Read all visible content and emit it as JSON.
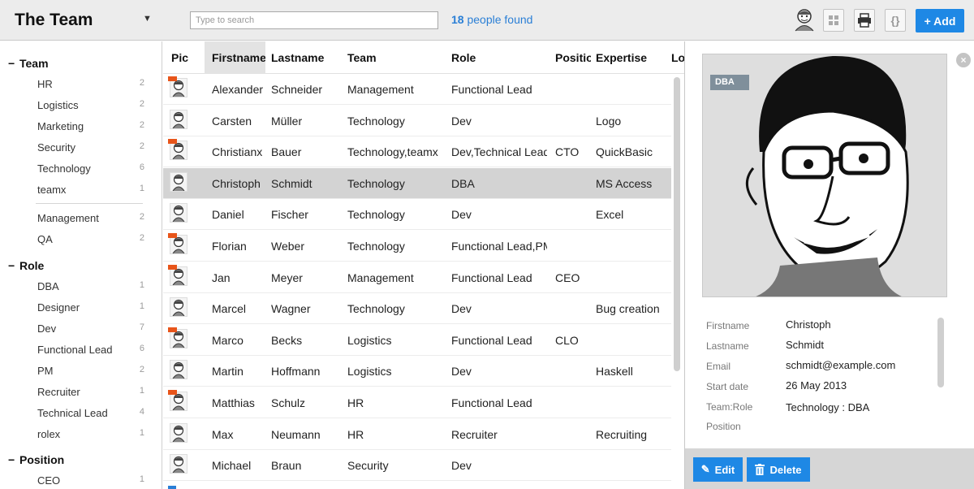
{
  "app": {
    "title": "The Team"
  },
  "search": {
    "placeholder": "Type to search",
    "found_count": "18",
    "found_text": "people found"
  },
  "toolbar": {
    "add_label": "+ Add"
  },
  "sidebar": {
    "groups": [
      {
        "label": "Team",
        "items": [
          {
            "label": "HR",
            "count": "2"
          },
          {
            "label": "Logistics",
            "count": "2"
          },
          {
            "label": "Marketing",
            "count": "2"
          },
          {
            "label": "Security",
            "count": "2"
          },
          {
            "label": "Technology",
            "count": "6"
          },
          {
            "label": "teamx",
            "count": "1"
          },
          {
            "label": "Management",
            "count": "2"
          },
          {
            "label": "QA",
            "count": "2"
          }
        ]
      },
      {
        "label": "Role",
        "items": [
          {
            "label": "DBA",
            "count": "1"
          },
          {
            "label": "Designer",
            "count": "1"
          },
          {
            "label": "Dev",
            "count": "7"
          },
          {
            "label": "Functional Lead",
            "count": "6"
          },
          {
            "label": "PM",
            "count": "2"
          },
          {
            "label": "Recruiter",
            "count": "1"
          },
          {
            "label": "Technical Lead",
            "count": "4"
          },
          {
            "label": "rolex",
            "count": "1"
          }
        ]
      },
      {
        "label": "Position",
        "items": [
          {
            "label": "CEO",
            "count": "1"
          }
        ]
      }
    ]
  },
  "table": {
    "columns": [
      "Pic",
      "Firstname",
      "Lastname",
      "Team",
      "Role",
      "Position",
      "Expertise",
      "Lo"
    ],
    "rows": [
      {
        "first": "Alexander",
        "last": "Schneider",
        "team": "Management",
        "role": "Functional Lead",
        "position": "",
        "expertise": "",
        "flag": true
      },
      {
        "first": "Carsten",
        "last": "Müller",
        "team": "Technology",
        "role": "Dev",
        "position": "",
        "expertise": "Logo",
        "flag": false
      },
      {
        "first": "Christianx",
        "last": "Bauer",
        "team": "Technology,teamx",
        "role": "Dev,Technical Lead",
        "position": "CTO",
        "expertise": "QuickBasic",
        "flag": true
      },
      {
        "first": "Christoph",
        "last": "Schmidt",
        "team": "Technology",
        "role": "DBA",
        "position": "",
        "expertise": "MS Access",
        "flag": false
      },
      {
        "first": "Daniel",
        "last": "Fischer",
        "team": "Technology",
        "role": "Dev",
        "position": "",
        "expertise": "Excel",
        "flag": false
      },
      {
        "first": "Florian",
        "last": "Weber",
        "team": "Technology",
        "role": "Functional Lead,PM",
        "position": "",
        "expertise": "",
        "flag": true
      },
      {
        "first": "Jan",
        "last": "Meyer",
        "team": "Management",
        "role": "Functional Lead",
        "position": "CEO",
        "expertise": "",
        "flag": true
      },
      {
        "first": "Marcel",
        "last": "Wagner",
        "team": "Technology",
        "role": "Dev",
        "position": "",
        "expertise": "Bug creation",
        "flag": false
      },
      {
        "first": "Marco",
        "last": "Becks",
        "team": "Logistics",
        "role": "Functional Lead",
        "position": "CLO",
        "expertise": "",
        "flag": true
      },
      {
        "first": "Martin",
        "last": "Hoffmann",
        "team": "Logistics",
        "role": "Dev",
        "position": "",
        "expertise": "Haskell",
        "flag": false
      },
      {
        "first": "Matthias",
        "last": "Schulz",
        "team": "HR",
        "role": "Functional Lead",
        "position": "",
        "expertise": "",
        "flag": true
      },
      {
        "first": "Max",
        "last": "Neumann",
        "team": "HR",
        "role": "Recruiter",
        "position": "",
        "expertise": "Recruiting",
        "flag": false
      },
      {
        "first": "Michael",
        "last": "Braun",
        "team": "Security",
        "role": "Dev",
        "position": "",
        "expertise": "",
        "flag": false
      }
    ]
  },
  "detail": {
    "badge": "DBA",
    "fields": [
      {
        "label": "Firstname",
        "value": "Christoph"
      },
      {
        "label": "Lastname",
        "value": "Schmidt"
      },
      {
        "label": "Email",
        "value": "schmidt@example.com"
      },
      {
        "label": "Start date",
        "value": "26 May 2013"
      },
      {
        "label": "Team:Role",
        "value": "Technology : DBA"
      },
      {
        "label": "Position",
        "value": ""
      }
    ],
    "edit_label": "Edit",
    "delete_label": "Delete"
  },
  "colors": {
    "accent": "#1e88e5",
    "flag": "#e8551a",
    "selected_row": "#d3d3d3"
  }
}
